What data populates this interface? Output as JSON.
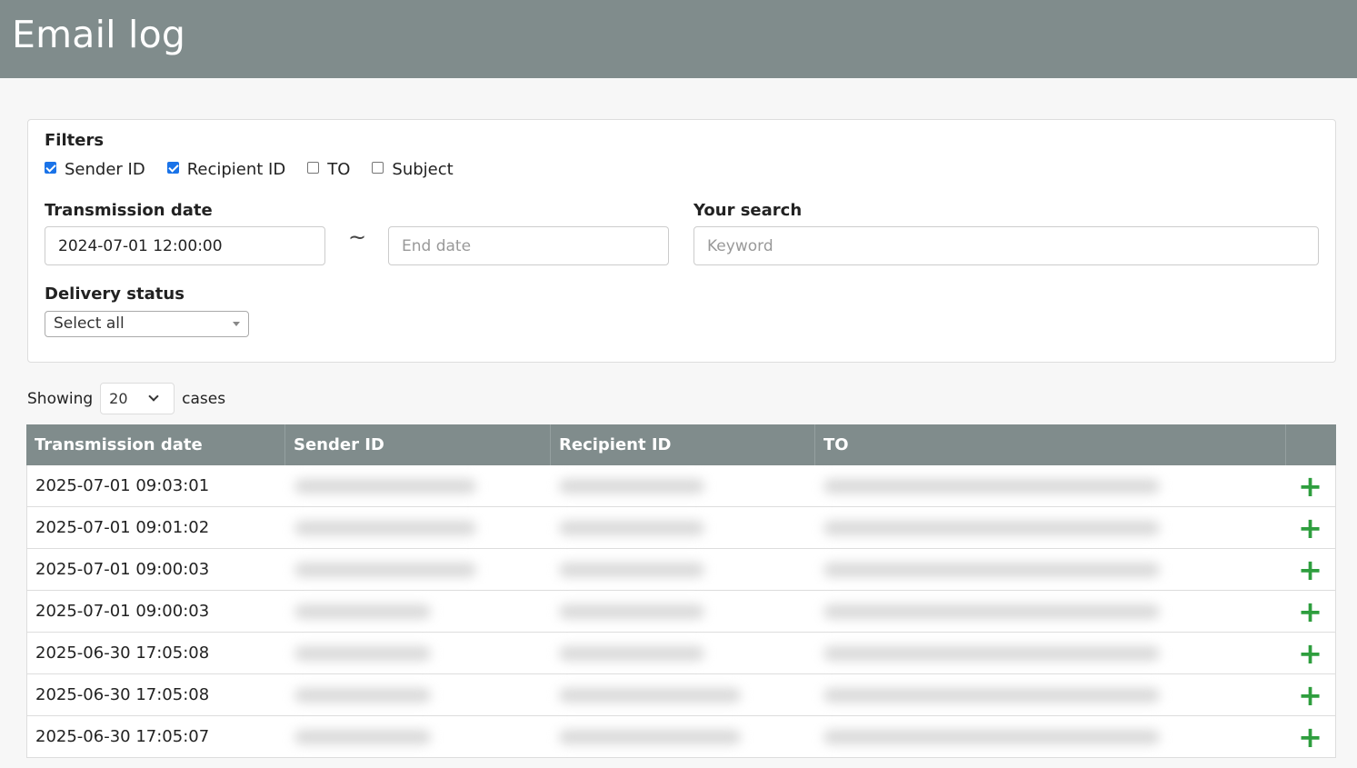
{
  "header": {
    "title": "Email log"
  },
  "filters": {
    "heading": "Filters",
    "checkboxes": [
      {
        "label": "Sender ID",
        "checked": true
      },
      {
        "label": "Recipient ID",
        "checked": true
      },
      {
        "label": "TO",
        "checked": false
      },
      {
        "label": "Subject",
        "checked": false
      }
    ],
    "transmission_date": {
      "label": "Transmission date",
      "start_value": "2024-07-01 12:00:00",
      "separator": "~",
      "end_placeholder": "End date"
    },
    "search": {
      "label": "Your search",
      "placeholder": "Keyword"
    },
    "delivery_status": {
      "label": "Delivery status",
      "selected": "Select all"
    }
  },
  "length": {
    "prefix": "Showing",
    "value": "20",
    "suffix": "cases"
  },
  "table": {
    "columns": [
      "Transmission date",
      "Sender ID",
      "Recipient ID",
      "TO",
      ""
    ],
    "rows": [
      {
        "date": "2025-07-01 09:03:01"
      },
      {
        "date": "2025-07-01 09:01:02"
      },
      {
        "date": "2025-07-01 09:00:03"
      },
      {
        "date": "2025-07-01 09:00:03"
      },
      {
        "date": "2025-06-30 17:05:08"
      },
      {
        "date": "2025-06-30 17:05:08"
      },
      {
        "date": "2025-06-30 17:05:07"
      }
    ],
    "expand_icon": "+"
  },
  "colors": {
    "header_bg": "#808c8c",
    "accent_check": "#1a73e8",
    "expand_green": "#2e9e3e"
  }
}
